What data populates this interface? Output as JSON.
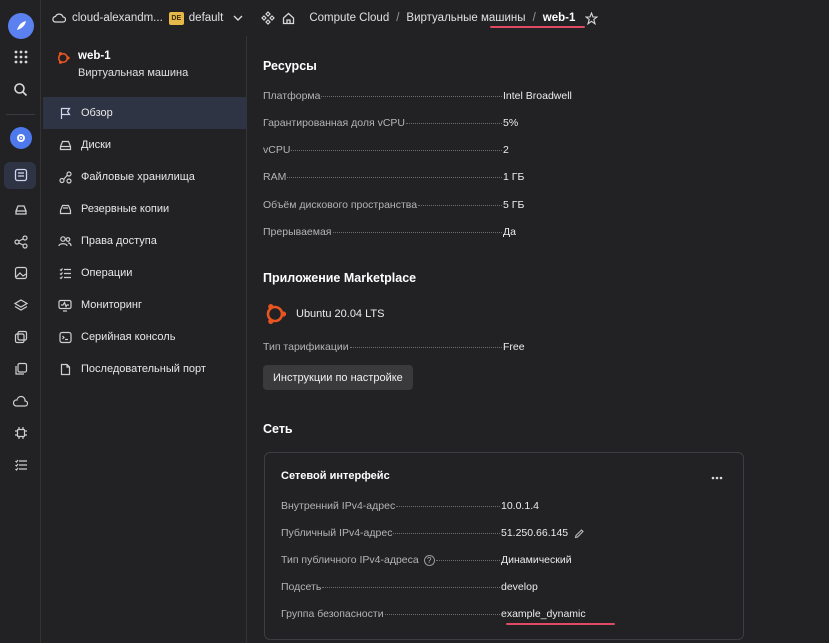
{
  "topbar": {
    "cloud_name": "cloud-alexandm...",
    "folder_badge": "DE",
    "folder_name": "default",
    "breadcrumbs": [
      "Compute Cloud",
      "Виртуальные машины",
      "web-1"
    ],
    "separator": "/"
  },
  "rail": {
    "icons": [
      "logo-icon",
      "apps-grid-icon",
      "search-icon",
      "compute-cloud-icon",
      "vm-icon",
      "disk-icon",
      "network-icon",
      "image-icon",
      "layers-icon",
      "snapshot-icon",
      "copy-icon",
      "scale-icon",
      "cpu-icon",
      "list-icon"
    ]
  },
  "subnav": {
    "vm_name": "web-1",
    "vm_type": "Виртуальная машина",
    "items": [
      {
        "label": "Обзор",
        "icon": "flag-icon",
        "active": true
      },
      {
        "label": "Диски",
        "icon": "disk-icon"
      },
      {
        "label": "Файловые хранилища",
        "icon": "file-storage-icon"
      },
      {
        "label": "Резервные копии",
        "icon": "backup-icon"
      },
      {
        "label": "Права доступа",
        "icon": "users-icon"
      },
      {
        "label": "Операции",
        "icon": "operations-icon"
      },
      {
        "label": "Мониторинг",
        "icon": "monitoring-icon"
      },
      {
        "label": "Серийная консоль",
        "icon": "console-icon"
      },
      {
        "label": "Последовательный порт",
        "icon": "port-icon"
      }
    ]
  },
  "resources": {
    "title": "Ресурсы",
    "rows": [
      {
        "key": "Платформа",
        "value": "Intel Broadwell"
      },
      {
        "key": "Гарантированная доля vCPU",
        "value": "5%"
      },
      {
        "key": "vCPU",
        "value": "2"
      },
      {
        "key": "RAM",
        "value": "1 ГБ"
      },
      {
        "key": "Объём дискового пространства",
        "value": "5 ГБ"
      },
      {
        "key": "Прерываемая",
        "value": "Да"
      }
    ]
  },
  "marketplace": {
    "title": "Приложение Marketplace",
    "product": "Ubuntu 20.04 LTS",
    "billing_key": "Тип тарификации",
    "billing_value": "Free",
    "instructions_button": "Инструкции по настройке"
  },
  "network": {
    "title": "Сеть",
    "card_title": "Сетевой интерфейс",
    "rows": [
      {
        "key": "Внутренний IPv4-адрес",
        "value": "10.0.1.4"
      },
      {
        "key": "Публичный IPv4-адрес",
        "value": "51.250.66.145"
      },
      {
        "key": "Тип публичного IPv4-адреса",
        "value": "Динамический"
      },
      {
        "key": "Подсеть",
        "value": "develop"
      },
      {
        "key": "Группа безопасности",
        "value": "example_dynamic"
      }
    ]
  },
  "colors": {
    "accent": "#5f8ef5",
    "annotation": "#e04b63",
    "badge": "#e6b84a"
  }
}
